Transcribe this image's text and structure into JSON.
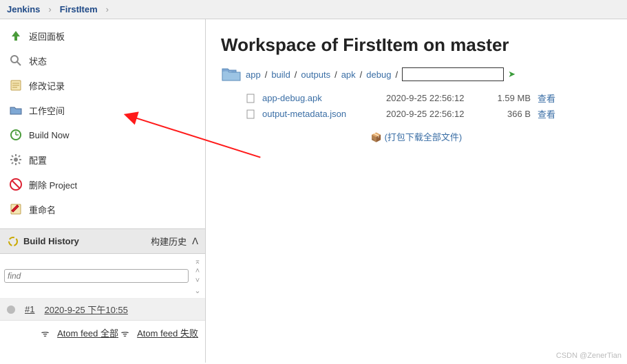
{
  "breadcrumb": {
    "a": "Jenkins",
    "b": "FirstItem"
  },
  "sidebar": {
    "items": [
      {
        "label": "返回面板"
      },
      {
        "label": "状态"
      },
      {
        "label": "修改记录"
      },
      {
        "label": "工作空间"
      },
      {
        "label": "Build Now"
      },
      {
        "label": "配置"
      },
      {
        "label": "删除 Project"
      },
      {
        "label": "重命名"
      }
    ]
  },
  "build_history": {
    "title": "Build History",
    "sub": "构建历史",
    "find_placeholder": "find",
    "rows": [
      {
        "num": "#1",
        "time": "2020-9-25 下午10:55"
      }
    ],
    "feed_all": "Atom feed 全部",
    "feed_fail": "Atom feed 失败"
  },
  "main": {
    "title": "Workspace of FirstItem on master",
    "path": [
      "app",
      "build",
      "outputs",
      "apk",
      "debug"
    ],
    "files": [
      {
        "name": "app-debug.apk",
        "date": "2020-9-25 22:56:12",
        "size": "1.59 MB",
        "view": "查看"
      },
      {
        "name": "output-metadata.json",
        "date": "2020-9-25 22:56:12",
        "size": "366 B",
        "view": "查看"
      }
    ],
    "download_all": "(打包下载全部文件)"
  },
  "watermark": "CSDN @ZenerTian"
}
